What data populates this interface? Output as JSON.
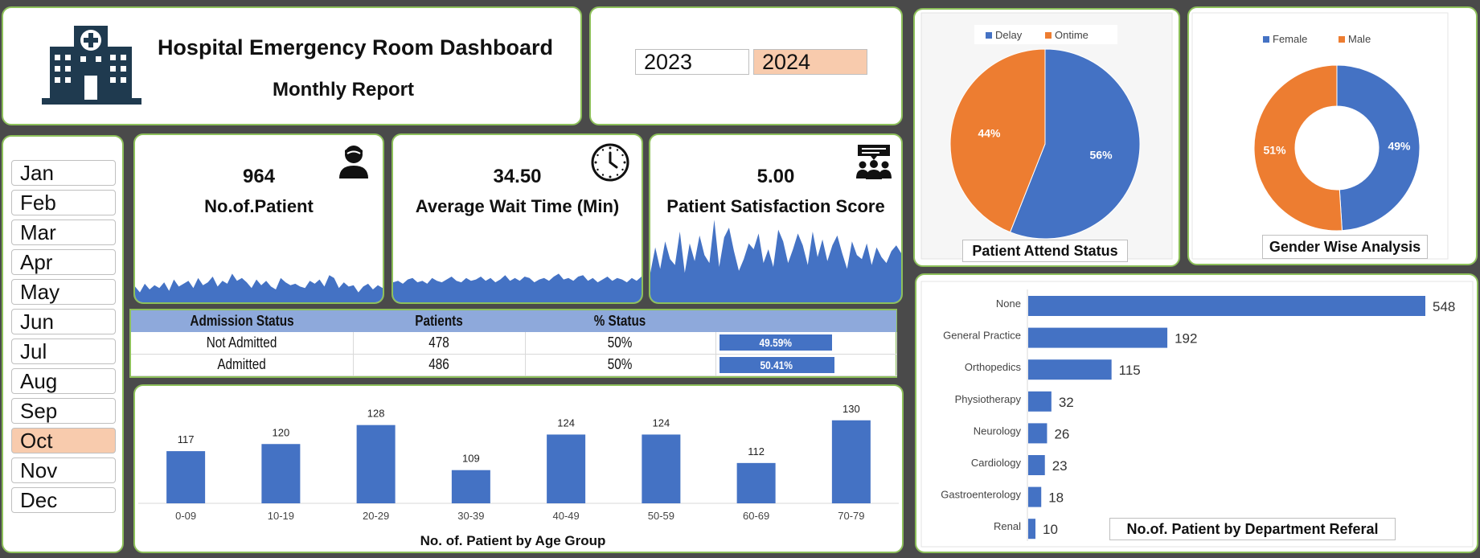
{
  "header": {
    "title": "Hospital Emergency Room Dashboard",
    "subtitle": "Monthly Report",
    "logo_icon": "hospital-icon"
  },
  "years": {
    "items": [
      {
        "label": "2023",
        "selected": false
      },
      {
        "label": "2024",
        "selected": true
      }
    ]
  },
  "months": {
    "items": [
      {
        "label": "Jan",
        "selected": false
      },
      {
        "label": "Feb",
        "selected": false
      },
      {
        "label": "Mar",
        "selected": false
      },
      {
        "label": "Apr",
        "selected": false
      },
      {
        "label": "May",
        "selected": false
      },
      {
        "label": "Jun",
        "selected": false
      },
      {
        "label": "Jul",
        "selected": false
      },
      {
        "label": "Aug",
        "selected": false
      },
      {
        "label": "Sep",
        "selected": false
      },
      {
        "label": "Oct",
        "selected": true
      },
      {
        "label": "Nov",
        "selected": false
      },
      {
        "label": "Dec",
        "selected": false
      }
    ]
  },
  "kpis": [
    {
      "value": "964",
      "label": "No.of.Patient",
      "icon": "patient-icon"
    },
    {
      "value": "34.50",
      "label": "Average Wait Time (Min)",
      "icon": "clock-icon"
    },
    {
      "value": "5.00",
      "label": "Patient Satisfaction Score",
      "icon": "feedback-group-icon"
    }
  ],
  "admission": {
    "headers": [
      "Admission Status",
      "Patients",
      "% Status",
      ""
    ],
    "rows": [
      {
        "status": "Not Admitted",
        "patients": "478",
        "pct": "50%",
        "bar_label": "49.59%",
        "bar_value": 49.59
      },
      {
        "status": "Admitted",
        "patients": "486",
        "pct": "50%",
        "bar_label": "50.41%",
        "bar_value": 50.41
      }
    ]
  },
  "colors": {
    "blue": "#4472c4",
    "orange": "#ed7d31",
    "panel_border": "#8dc05a",
    "selected": "#f8cbad",
    "table_header": "#8ea9db",
    "icon_dark": "#1f3a4f"
  },
  "chart_data": [
    {
      "type": "area",
      "id": "patients-sparkline",
      "values": [
        22,
        14,
        26,
        18,
        24,
        20,
        28,
        16,
        32,
        22,
        26,
        30,
        20,
        34,
        24,
        28,
        36,
        22,
        30,
        26,
        40,
        30,
        34,
        28,
        20,
        32,
        24,
        30,
        22,
        18,
        34,
        28,
        24,
        26,
        22,
        20,
        30,
        26,
        32,
        22,
        38,
        34,
        20,
        28,
        22,
        24,
        14,
        22,
        26,
        18,
        24,
        20
      ],
      "ylim": [
        0,
        90
      ]
    },
    {
      "type": "area",
      "id": "wait-sparkline",
      "values": [
        28,
        30,
        26,
        32,
        34,
        28,
        30,
        26,
        34,
        30,
        28,
        32,
        36,
        30,
        28,
        34,
        30,
        32,
        36,
        30,
        34,
        28,
        32,
        38,
        30,
        34,
        30,
        36,
        34,
        28,
        32,
        34,
        30,
        36,
        40,
        32,
        34,
        30,
        36,
        38,
        30,
        34,
        28,
        32,
        36,
        30,
        34,
        32,
        28,
        34,
        30,
        36
      ],
      "ylim": [
        0,
        90
      ]
    },
    {
      "type": "area",
      "id": "satisfaction-sparkline",
      "values": [
        30,
        56,
        34,
        62,
        44,
        38,
        72,
        30,
        60,
        42,
        68,
        48,
        40,
        84,
        36,
        66,
        76,
        52,
        32,
        44,
        60,
        54,
        70,
        40,
        54,
        36,
        74,
        62,
        40,
        54,
        70,
        58,
        38,
        72,
        46,
        64,
        42,
        58,
        68,
        50,
        34,
        62,
        48,
        44,
        60,
        38,
        56,
        46,
        40,
        52,
        58,
        50
      ],
      "ylim": [
        0,
        90
      ]
    },
    {
      "type": "bar",
      "id": "age-group",
      "title": "No. of. Patient by Age Group",
      "categories": [
        "0-09",
        "10-19",
        "20-29",
        "30-39",
        "40-49",
        "50-59",
        "60-69",
        "70-79"
      ],
      "values": [
        117,
        120,
        128,
        109,
        124,
        124,
        112,
        130
      ],
      "ylim": [
        95,
        135
      ]
    },
    {
      "type": "pie",
      "id": "attend-status",
      "title": "Patient Attend Status",
      "categories": [
        "Delay",
        "Ontime"
      ],
      "values": [
        56,
        44
      ],
      "labels": [
        "56%",
        "44%"
      ],
      "legend": "top"
    },
    {
      "type": "pie",
      "id": "gender",
      "title": "Gender Wise Analysis",
      "donut": true,
      "categories": [
        "Female",
        "Male"
      ],
      "values": [
        49,
        51
      ],
      "labels": [
        "49%",
        "51%"
      ],
      "legend": "top"
    },
    {
      "type": "bar",
      "id": "department",
      "orientation": "horizontal",
      "title": "No.of. Patient by Department Referal",
      "categories": [
        "None",
        "General Practice",
        "Orthopedics",
        "Physiotherapy",
        "Neurology",
        "Cardiology",
        "Gastroenterology",
        "Renal"
      ],
      "values": [
        548,
        192,
        115,
        32,
        26,
        23,
        18,
        10
      ],
      "xlim": [
        0,
        548
      ]
    }
  ]
}
